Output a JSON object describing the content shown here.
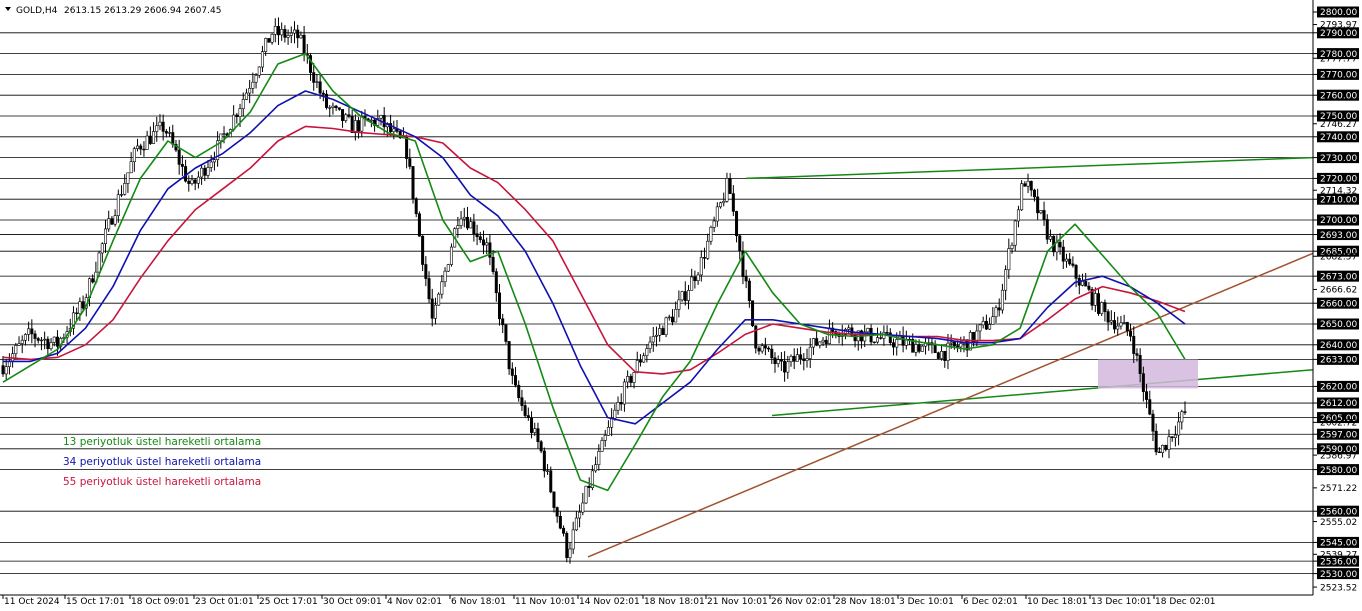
{
  "header": {
    "symbol_label": "GOLD,H4",
    "ohlc": "2613.15 2613.29 2606.94 2607.45"
  },
  "legend": [
    {
      "label": "13 periyotluk üstel hareketli ortalama",
      "color": "#138a13"
    },
    {
      "label": "34 periyotluk üstel hareketli ortalama",
      "color": "#1010b0"
    },
    {
      "label": "55 periyotluk üstel hareketli ortalama",
      "color": "#c8143c"
    }
  ],
  "chart_data": {
    "type": "candlestick",
    "symbol": "GOLD",
    "timeframe": "H4",
    "ylim": [
      2525,
      2800
    ],
    "y_ticks": [
      "2800.00",
      "2793.97",
      "2790.00",
      "2777.77",
      "2780.00",
      "2770.00",
      "2760.00",
      "2750.00",
      "2746.27",
      "2740.00",
      "2730.00",
      "2720.00",
      "2714.32",
      "2710.00",
      "2700.00",
      "2693.00",
      "2685.00",
      "2682.57",
      "2673.00",
      "2666.62",
      "2660.00",
      "2650.00",
      "2640.00",
      "2633.00",
      "2620.00",
      "2612.00",
      "2605.00",
      "2602.72",
      "2597.00",
      "2590.00",
      "2586.97",
      "2580.00",
      "2571.22",
      "2560.00",
      "2555.02",
      "2545.00",
      "2539.27",
      "2536.00",
      "2530.00",
      "2523.52"
    ],
    "x_ticks": [
      "11 Oct 2024",
      "15 Oct 17:01",
      "18 Oct 09:01",
      "23 Oct 01:01",
      "25 Oct 17:01",
      "30 Oct 09:01",
      "4 Nov 02:01",
      "6 Nov 18:01",
      "11 Nov 10:01",
      "14 Nov 02:01",
      "18 Nov 18:01",
      "21 Nov 10:01",
      "26 Nov 02:01",
      "28 Nov 18:01",
      "3 Dec 10:01",
      "6 Dec 02:01",
      "10 Dec 18:01",
      "13 Dec 10:01",
      "18 Dec 02:01"
    ],
    "horizontal_levels": [
      2790,
      2780,
      2770,
      2760,
      2750,
      2740,
      2730,
      2720,
      2710,
      2700,
      2693,
      2685,
      2673,
      2660,
      2650,
      2640,
      2633,
      2620,
      2612,
      2605,
      2597,
      2590,
      2580,
      2560,
      2545,
      2536,
      2530
    ],
    "price_path": [
      2630,
      2645,
      2640,
      2660,
      2700,
      2735,
      2745,
      2715,
      2735,
      2760,
      2790,
      2788,
      2755,
      2745,
      2748,
      2735,
      2650,
      2705,
      2688,
      2620,
      2590,
      2540,
      2580,
      2615,
      2640,
      2655,
      2680,
      2718,
      2642,
      2628,
      2638,
      2648,
      2645,
      2642,
      2640,
      2636,
      2642,
      2655,
      2720,
      2690,
      2672,
      2655,
      2645,
      2587,
      2607.45
    ],
    "ema13": [
      2622,
      2630,
      2638,
      2658,
      2690,
      2720,
      2738,
      2730,
      2738,
      2752,
      2775,
      2780,
      2762,
      2750,
      2742,
      2738,
      2700,
      2680,
      2685,
      2650,
      2610,
      2575,
      2570,
      2592,
      2615,
      2632,
      2660,
      2685,
      2665,
      2650,
      2645,
      2644,
      2645,
      2642,
      2640,
      2638,
      2640,
      2648,
      2685,
      2698,
      2683,
      2668,
      2655,
      2633
    ],
    "ema34": [
      2632,
      2632,
      2636,
      2648,
      2668,
      2695,
      2715,
      2725,
      2732,
      2742,
      2755,
      2762,
      2758,
      2752,
      2746,
      2740,
      2730,
      2712,
      2702,
      2685,
      2660,
      2630,
      2605,
      2602,
      2612,
      2622,
      2638,
      2652,
      2652,
      2650,
      2648,
      2646,
      2645,
      2644,
      2643,
      2641,
      2641,
      2643,
      2658,
      2670,
      2673,
      2668,
      2660,
      2650
    ],
    "ema55": [
      2634,
      2633,
      2634,
      2640,
      2652,
      2672,
      2690,
      2705,
      2715,
      2725,
      2738,
      2745,
      2744,
      2742,
      2741,
      2740,
      2737,
      2725,
      2718,
      2705,
      2690,
      2665,
      2640,
      2627,
      2626,
      2628,
      2636,
      2645,
      2650,
      2648,
      2646,
      2645,
      2645,
      2644,
      2644,
      2642,
      2642,
      2643,
      2652,
      2662,
      2668,
      2665,
      2661,
      2656
    ],
    "trendlines": [
      {
        "name": "resistance",
        "color": "#138a13",
        "from": [
          "21 Nov 10:01",
          2720
        ],
        "to": [
          "18 Dec 02:01+",
          2730
        ]
      },
      {
        "name": "support-upper",
        "color": "#138a13",
        "from": [
          "26 Nov 02:01",
          2606
        ],
        "to": [
          "18 Dec 02:01+",
          2628
        ]
      },
      {
        "name": "rising-support",
        "color": "#a0522d",
        "from": [
          "14 Nov 02:01",
          2538
        ],
        "to": [
          "18 Dec 02:01+",
          2684
        ]
      }
    ],
    "zone": {
      "color": "#d4b8dd",
      "from_price": 2619,
      "to_price": 2633
    },
    "grid": false,
    "legend_position": "bottom-left"
  }
}
